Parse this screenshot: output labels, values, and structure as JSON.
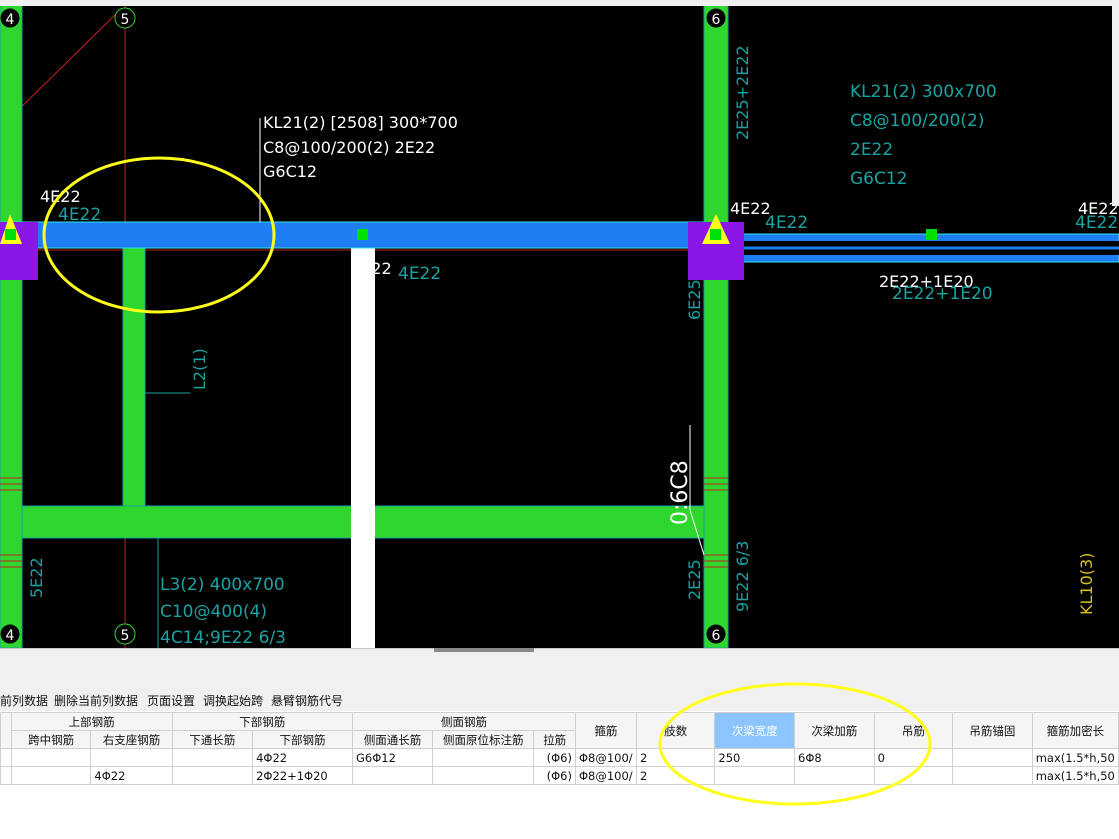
{
  "cad": {
    "grid_labels": {
      "axis4_top": "4",
      "axis5_top": "5",
      "axis6_top": "6",
      "axis4_bottom": "4",
      "axis5_bottom": "5",
      "axis6_bottom": "6"
    },
    "beam_kl21_annotation": {
      "line1": "KL21(2) [2508] 300*700",
      "line2": "C8@100/200(2) 2E22",
      "line3": "G6C12"
    },
    "beam_kl21_right_annotation": {
      "line1": "KL21(2) 300x700",
      "line2": "C8@100/200(2)",
      "line3": "2E22",
      "line4": "G6C12"
    },
    "rebar_labels": {
      "left_top_white": "4E22",
      "left_top_teal": "4E22",
      "mid_bottom_white": "4E22",
      "mid_bottom_teal": "4E22",
      "right_top_white": "4E22",
      "right_top_teal": "4E22",
      "far_right_white": "4E22",
      "far_right_teal": "4E22",
      "right_bottom_white": "2E22+1E20",
      "right_bottom_teal": "2E22+1E20",
      "vertical_top_right": "2E25+2E22",
      "vertical_6e25": "6E25",
      "vertical_2e25": "2E25",
      "vertical_9e22": "9E22 6/3",
      "vertical_5e22": "5E22",
      "vertical_l2": "L2(1)",
      "vertical_kl10": "KL10(3)",
      "vertical_stirrup": "0:6C8"
    },
    "beam_l3_annotation": {
      "line1": "L3(2) 400x700",
      "line2": "C10@400(4)",
      "line3": "4C14;9E22 6/3"
    },
    "colors": {
      "background": "#000000",
      "main_beam": "#1e7ff5",
      "secondary_beam": "#2ed62e",
      "column": "#8a17e6",
      "highlight_ring": "#ffff1a",
      "teal_text": "#1aa3a3"
    }
  },
  "toolbar": {
    "items": [
      "前列数据",
      "删除当前列数据",
      "页面设置",
      "调换起始跨",
      "悬臂钢筋代号"
    ]
  },
  "table": {
    "group_headers": {
      "top_rebar": "上部钢筋",
      "bottom_rebar": "下部钢筋",
      "side_rebar": "侧面钢筋"
    },
    "headers": {
      "mid_span": "跨中钢筋",
      "right_support": "右支座钢筋",
      "bottom_through": "下通长筋",
      "bottom_rebar": "下部钢筋",
      "side_through": "侧面通长筋",
      "side_in_place": "侧面原位标注筋",
      "tie_bar": "拉筋",
      "stirrup": "箍筋",
      "legs": "肢数",
      "sec_beam_width": "次梁宽度",
      "sec_beam_rebar": "次梁加筋",
      "hanger": "吊筋",
      "hanger_anchor": "吊筋锚固",
      "stirrup_dense_len": "箍筋加密长"
    },
    "rows": [
      {
        "mid_span": "",
        "right_support": "",
        "bottom_through": "",
        "bottom_rebar": "4Φ22",
        "side_through": "G6Φ12",
        "side_in_place": "",
        "tie_bar": "(Φ6)",
        "stirrup": "Φ8@100/",
        "legs": "2",
        "sec_beam_width": "250",
        "sec_beam_rebar": "6Φ8",
        "hanger": "0",
        "hanger_anchor": "",
        "stirrup_dense_len": "max(1.5*h,50"
      },
      {
        "mid_span": "",
        "right_support": "4Φ22",
        "bottom_through": "",
        "bottom_rebar": "2Φ22+1Φ20",
        "side_through": "",
        "side_in_place": "",
        "tie_bar": "(Φ6)",
        "stirrup": "Φ8@100/",
        "legs": "2",
        "sec_beam_width": "",
        "sec_beam_rebar": "",
        "hanger": "",
        "hanger_anchor": "",
        "stirrup_dense_len": "max(1.5*h,50"
      }
    ]
  }
}
